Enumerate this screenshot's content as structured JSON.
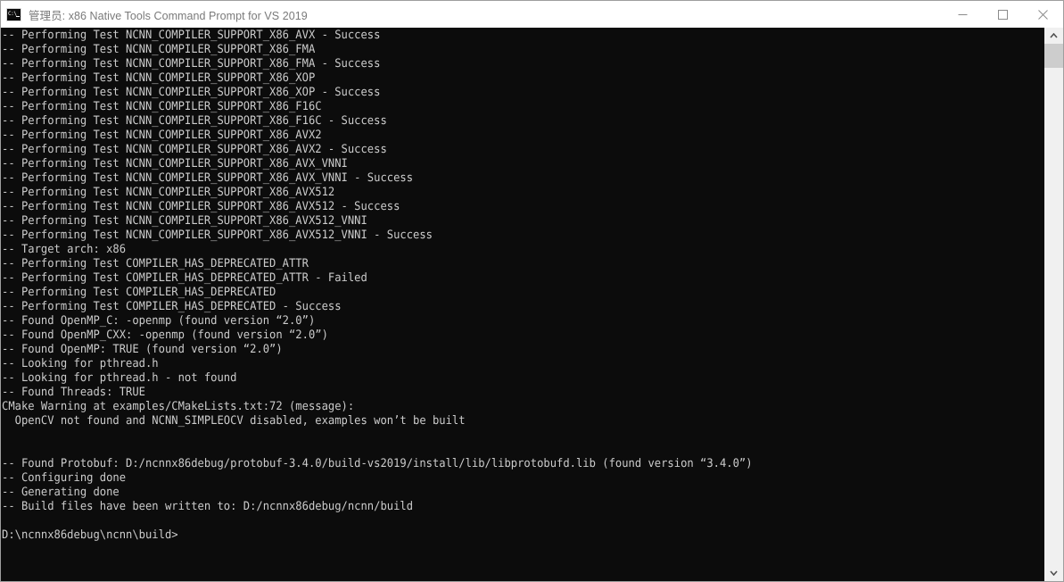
{
  "window": {
    "title": "管理员: x86 Native Tools Command Prompt for VS 2019",
    "icon": "cmd-icon",
    "background_color": "#0c0c0c",
    "text_color": "#cccccc",
    "titlebar_text_color": "#7a7a7a"
  },
  "titlebar_buttons": {
    "minimize": "minimize-icon",
    "maximize": "maximize-icon",
    "close": "close-icon"
  },
  "scrollbar": {
    "up_arrow": "chevron-up-icon",
    "down_arrow": "chevron-down-icon",
    "thumb_position": "top"
  },
  "terminal": {
    "prompt": "D:\\ncnnx86debug\\ncnn\\build>",
    "lines": [
      "-- Performing Test NCNN_COMPILER_SUPPORT_X86_AVX - Success",
      "-- Performing Test NCNN_COMPILER_SUPPORT_X86_FMA",
      "-- Performing Test NCNN_COMPILER_SUPPORT_X86_FMA - Success",
      "-- Performing Test NCNN_COMPILER_SUPPORT_X86_XOP",
      "-- Performing Test NCNN_COMPILER_SUPPORT_X86_XOP - Success",
      "-- Performing Test NCNN_COMPILER_SUPPORT_X86_F16C",
      "-- Performing Test NCNN_COMPILER_SUPPORT_X86_F16C - Success",
      "-- Performing Test NCNN_COMPILER_SUPPORT_X86_AVX2",
      "-- Performing Test NCNN_COMPILER_SUPPORT_X86_AVX2 - Success",
      "-- Performing Test NCNN_COMPILER_SUPPORT_X86_AVX_VNNI",
      "-- Performing Test NCNN_COMPILER_SUPPORT_X86_AVX_VNNI - Success",
      "-- Performing Test NCNN_COMPILER_SUPPORT_X86_AVX512",
      "-- Performing Test NCNN_COMPILER_SUPPORT_X86_AVX512 - Success",
      "-- Performing Test NCNN_COMPILER_SUPPORT_X86_AVX512_VNNI",
      "-- Performing Test NCNN_COMPILER_SUPPORT_X86_AVX512_VNNI - Success",
      "-- Target arch: x86",
      "-- Performing Test COMPILER_HAS_DEPRECATED_ATTR",
      "-- Performing Test COMPILER_HAS_DEPRECATED_ATTR - Failed",
      "-- Performing Test COMPILER_HAS_DEPRECATED",
      "-- Performing Test COMPILER_HAS_DEPRECATED - Success",
      "-- Found OpenMP_C: -openmp (found version “2.0”)",
      "-- Found OpenMP_CXX: -openmp (found version “2.0”)",
      "-- Found OpenMP: TRUE (found version “2.0”)",
      "-- Looking for pthread.h",
      "-- Looking for pthread.h - not found",
      "-- Found Threads: TRUE",
      "CMake Warning at examples/CMakeLists.txt:72 (message):",
      "  OpenCV not found and NCNN_SIMPLEOCV disabled, examples won’t be built",
      "",
      "",
      "-- Found Protobuf: D:/ncnnx86debug/protobuf-3.4.0/build-vs2019/install/lib/libprotobufd.lib (found version “3.4.0”)",
      "-- Configuring done",
      "-- Generating done",
      "-- Build files have been written to: D:/ncnnx86debug/ncnn/build",
      "",
      "D:\\ncnnx86debug\\ncnn\\build>"
    ]
  }
}
